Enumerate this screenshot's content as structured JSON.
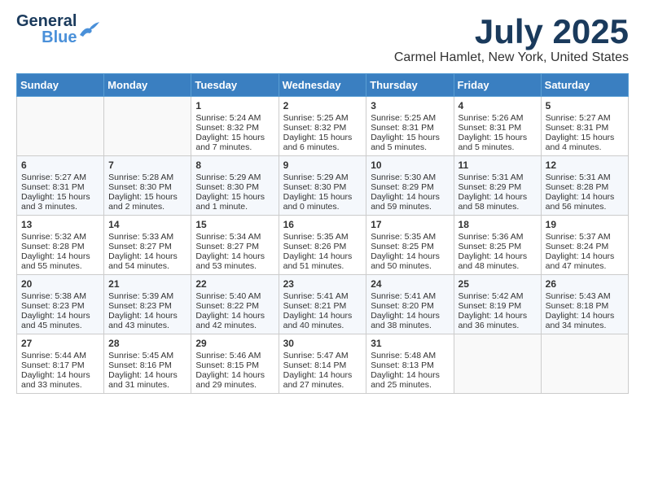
{
  "header": {
    "logo_general": "General",
    "logo_blue": "Blue",
    "month_title": "July 2025",
    "location": "Carmel Hamlet, New York, United States"
  },
  "weekdays": [
    "Sunday",
    "Monday",
    "Tuesday",
    "Wednesday",
    "Thursday",
    "Friday",
    "Saturday"
  ],
  "weeks": [
    [
      {
        "day": "",
        "sunrise": "",
        "sunset": "",
        "daylight": ""
      },
      {
        "day": "",
        "sunrise": "",
        "sunset": "",
        "daylight": ""
      },
      {
        "day": "1",
        "sunrise": "Sunrise: 5:24 AM",
        "sunset": "Sunset: 8:32 PM",
        "daylight": "Daylight: 15 hours and 7 minutes."
      },
      {
        "day": "2",
        "sunrise": "Sunrise: 5:25 AM",
        "sunset": "Sunset: 8:32 PM",
        "daylight": "Daylight: 15 hours and 6 minutes."
      },
      {
        "day": "3",
        "sunrise": "Sunrise: 5:25 AM",
        "sunset": "Sunset: 8:31 PM",
        "daylight": "Daylight: 15 hours and 5 minutes."
      },
      {
        "day": "4",
        "sunrise": "Sunrise: 5:26 AM",
        "sunset": "Sunset: 8:31 PM",
        "daylight": "Daylight: 15 hours and 5 minutes."
      },
      {
        "day": "5",
        "sunrise": "Sunrise: 5:27 AM",
        "sunset": "Sunset: 8:31 PM",
        "daylight": "Daylight: 15 hours and 4 minutes."
      }
    ],
    [
      {
        "day": "6",
        "sunrise": "Sunrise: 5:27 AM",
        "sunset": "Sunset: 8:31 PM",
        "daylight": "Daylight: 15 hours and 3 minutes."
      },
      {
        "day": "7",
        "sunrise": "Sunrise: 5:28 AM",
        "sunset": "Sunset: 8:30 PM",
        "daylight": "Daylight: 15 hours and 2 minutes."
      },
      {
        "day": "8",
        "sunrise": "Sunrise: 5:29 AM",
        "sunset": "Sunset: 8:30 PM",
        "daylight": "Daylight: 15 hours and 1 minute."
      },
      {
        "day": "9",
        "sunrise": "Sunrise: 5:29 AM",
        "sunset": "Sunset: 8:30 PM",
        "daylight": "Daylight: 15 hours and 0 minutes."
      },
      {
        "day": "10",
        "sunrise": "Sunrise: 5:30 AM",
        "sunset": "Sunset: 8:29 PM",
        "daylight": "Daylight: 14 hours and 59 minutes."
      },
      {
        "day": "11",
        "sunrise": "Sunrise: 5:31 AM",
        "sunset": "Sunset: 8:29 PM",
        "daylight": "Daylight: 14 hours and 58 minutes."
      },
      {
        "day": "12",
        "sunrise": "Sunrise: 5:31 AM",
        "sunset": "Sunset: 8:28 PM",
        "daylight": "Daylight: 14 hours and 56 minutes."
      }
    ],
    [
      {
        "day": "13",
        "sunrise": "Sunrise: 5:32 AM",
        "sunset": "Sunset: 8:28 PM",
        "daylight": "Daylight: 14 hours and 55 minutes."
      },
      {
        "day": "14",
        "sunrise": "Sunrise: 5:33 AM",
        "sunset": "Sunset: 8:27 PM",
        "daylight": "Daylight: 14 hours and 54 minutes."
      },
      {
        "day": "15",
        "sunrise": "Sunrise: 5:34 AM",
        "sunset": "Sunset: 8:27 PM",
        "daylight": "Daylight: 14 hours and 53 minutes."
      },
      {
        "day": "16",
        "sunrise": "Sunrise: 5:35 AM",
        "sunset": "Sunset: 8:26 PM",
        "daylight": "Daylight: 14 hours and 51 minutes."
      },
      {
        "day": "17",
        "sunrise": "Sunrise: 5:35 AM",
        "sunset": "Sunset: 8:25 PM",
        "daylight": "Daylight: 14 hours and 50 minutes."
      },
      {
        "day": "18",
        "sunrise": "Sunrise: 5:36 AM",
        "sunset": "Sunset: 8:25 PM",
        "daylight": "Daylight: 14 hours and 48 minutes."
      },
      {
        "day": "19",
        "sunrise": "Sunrise: 5:37 AM",
        "sunset": "Sunset: 8:24 PM",
        "daylight": "Daylight: 14 hours and 47 minutes."
      }
    ],
    [
      {
        "day": "20",
        "sunrise": "Sunrise: 5:38 AM",
        "sunset": "Sunset: 8:23 PM",
        "daylight": "Daylight: 14 hours and 45 minutes."
      },
      {
        "day": "21",
        "sunrise": "Sunrise: 5:39 AM",
        "sunset": "Sunset: 8:23 PM",
        "daylight": "Daylight: 14 hours and 43 minutes."
      },
      {
        "day": "22",
        "sunrise": "Sunrise: 5:40 AM",
        "sunset": "Sunset: 8:22 PM",
        "daylight": "Daylight: 14 hours and 42 minutes."
      },
      {
        "day": "23",
        "sunrise": "Sunrise: 5:41 AM",
        "sunset": "Sunset: 8:21 PM",
        "daylight": "Daylight: 14 hours and 40 minutes."
      },
      {
        "day": "24",
        "sunrise": "Sunrise: 5:41 AM",
        "sunset": "Sunset: 8:20 PM",
        "daylight": "Daylight: 14 hours and 38 minutes."
      },
      {
        "day": "25",
        "sunrise": "Sunrise: 5:42 AM",
        "sunset": "Sunset: 8:19 PM",
        "daylight": "Daylight: 14 hours and 36 minutes."
      },
      {
        "day": "26",
        "sunrise": "Sunrise: 5:43 AM",
        "sunset": "Sunset: 8:18 PM",
        "daylight": "Daylight: 14 hours and 34 minutes."
      }
    ],
    [
      {
        "day": "27",
        "sunrise": "Sunrise: 5:44 AM",
        "sunset": "Sunset: 8:17 PM",
        "daylight": "Daylight: 14 hours and 33 minutes."
      },
      {
        "day": "28",
        "sunrise": "Sunrise: 5:45 AM",
        "sunset": "Sunset: 8:16 PM",
        "daylight": "Daylight: 14 hours and 31 minutes."
      },
      {
        "day": "29",
        "sunrise": "Sunrise: 5:46 AM",
        "sunset": "Sunset: 8:15 PM",
        "daylight": "Daylight: 14 hours and 29 minutes."
      },
      {
        "day": "30",
        "sunrise": "Sunrise: 5:47 AM",
        "sunset": "Sunset: 8:14 PM",
        "daylight": "Daylight: 14 hours and 27 minutes."
      },
      {
        "day": "31",
        "sunrise": "Sunrise: 5:48 AM",
        "sunset": "Sunset: 8:13 PM",
        "daylight": "Daylight: 14 hours and 25 minutes."
      },
      {
        "day": "",
        "sunrise": "",
        "sunset": "",
        "daylight": ""
      },
      {
        "day": "",
        "sunrise": "",
        "sunset": "",
        "daylight": ""
      }
    ]
  ]
}
